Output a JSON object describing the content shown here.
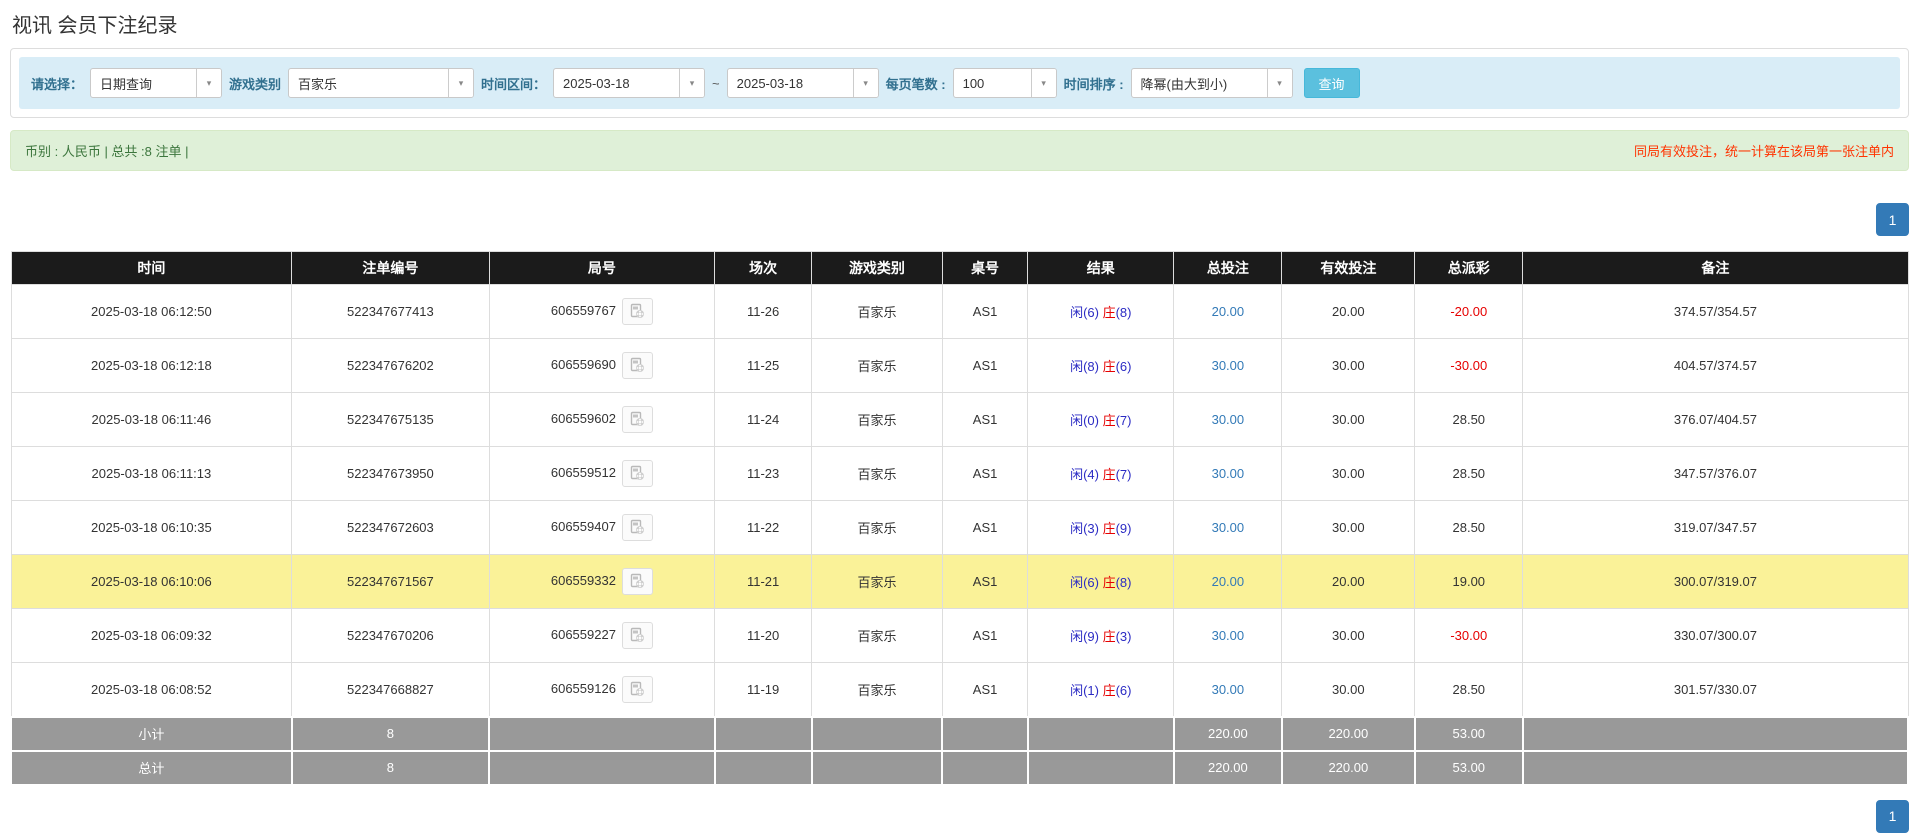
{
  "page": {
    "title": "视讯 会员下注纪录"
  },
  "filters": {
    "select_label": "请选择：",
    "select_value": "日期查询",
    "game_type_label": "游戏类别",
    "game_type_value": "百家乐",
    "time_range_label": "时间区间：",
    "date_from": "2025-03-18",
    "tilde": "~",
    "date_to": "2025-03-18",
    "per_page_label": "每页笔数 :",
    "per_page_value": "100",
    "sort_label": "时间排序 :",
    "sort_value": "降幂(由大到小)",
    "search_button": "查询"
  },
  "info_bar": {
    "left": "币别 : 人民币 | 总共 :8 注单 |",
    "right": "同局有效投注，统一计算在该局第一张注单内"
  },
  "pagination": {
    "page": "1"
  },
  "colors": {
    "accent": "#337ab7",
    "highlight": "#faf298",
    "header_bg": "#1b1b1b",
    "subtotal_bg": "#999999",
    "green_bg": "#dff0d8",
    "warn_red": "#ff3300",
    "result_player_blue": "#2b2bc4",
    "result_banker_red": "#e60000"
  },
  "table": {
    "headers": [
      "时间",
      "注单编号",
      "局号",
      "场次",
      "游戏类别",
      "桌号",
      "结果",
      "总投注",
      "有效投注",
      "总派彩",
      "备注"
    ],
    "rows": [
      {
        "time": "2025-03-18 06:12:50",
        "bet_id": "522347677413",
        "round": "606559767",
        "session": "11-26",
        "game": "百家乐",
        "table_no": "AS1",
        "player": "闲(6)",
        "banker": "庄",
        "banker_num": "(8)",
        "total_bet": "20.00",
        "valid_bet": "20.00",
        "payout": "-20.00",
        "remark": "374.57/354.57",
        "highlight": false
      },
      {
        "time": "2025-03-18 06:12:18",
        "bet_id": "522347676202",
        "round": "606559690",
        "session": "11-25",
        "game": "百家乐",
        "table_no": "AS1",
        "player": "闲(8)",
        "banker": "庄",
        "banker_num": "(6)",
        "total_bet": "30.00",
        "valid_bet": "30.00",
        "payout": "-30.00",
        "remark": "404.57/374.57",
        "highlight": false
      },
      {
        "time": "2025-03-18 06:11:46",
        "bet_id": "522347675135",
        "round": "606559602",
        "session": "11-24",
        "game": "百家乐",
        "table_no": "AS1",
        "player": "闲(0)",
        "banker": "庄",
        "banker_num": "(7)",
        "total_bet": "30.00",
        "valid_bet": "30.00",
        "payout": "28.50",
        "remark": "376.07/404.57",
        "highlight": false
      },
      {
        "time": "2025-03-18 06:11:13",
        "bet_id": "522347673950",
        "round": "606559512",
        "session": "11-23",
        "game": "百家乐",
        "table_no": "AS1",
        "player": "闲(4)",
        "banker": "庄",
        "banker_num": "(7)",
        "total_bet": "30.00",
        "valid_bet": "30.00",
        "payout": "28.50",
        "remark": "347.57/376.07",
        "highlight": false
      },
      {
        "time": "2025-03-18 06:10:35",
        "bet_id": "522347672603",
        "round": "606559407",
        "session": "11-22",
        "game": "百家乐",
        "table_no": "AS1",
        "player": "闲(3)",
        "banker": "庄",
        "banker_num": "(9)",
        "total_bet": "30.00",
        "valid_bet": "30.00",
        "payout": "28.50",
        "remark": "319.07/347.57",
        "highlight": false
      },
      {
        "time": "2025-03-18 06:10:06",
        "bet_id": "522347671567",
        "round": "606559332",
        "session": "11-21",
        "game": "百家乐",
        "table_no": "AS1",
        "player": "闲(6)",
        "banker": "庄",
        "banker_num": "(8)",
        "total_bet": "20.00",
        "valid_bet": "20.00",
        "payout": "19.00",
        "remark": "300.07/319.07",
        "highlight": true
      },
      {
        "time": "2025-03-18 06:09:32",
        "bet_id": "522347670206",
        "round": "606559227",
        "session": "11-20",
        "game": "百家乐",
        "table_no": "AS1",
        "player": "闲(9)",
        "banker": "庄",
        "banker_num": "(3)",
        "total_bet": "30.00",
        "valid_bet": "30.00",
        "payout": "-30.00",
        "remark": "330.07/300.07",
        "highlight": false
      },
      {
        "time": "2025-03-18 06:08:52",
        "bet_id": "522347668827",
        "round": "606559126",
        "session": "11-19",
        "game": "百家乐",
        "table_no": "AS1",
        "player": "闲(1)",
        "banker": "庄",
        "banker_num": "(6)",
        "total_bet": "30.00",
        "valid_bet": "30.00",
        "payout": "28.50",
        "remark": "301.57/330.07",
        "highlight": false
      }
    ],
    "subtotal": {
      "label": "小计",
      "count": "8",
      "total_bet": "220.00",
      "valid_bet": "220.00",
      "payout": "53.00"
    },
    "total": {
      "label": "总计",
      "count": "8",
      "total_bet": "220.00",
      "valid_bet": "220.00",
      "payout": "53.00"
    }
  }
}
